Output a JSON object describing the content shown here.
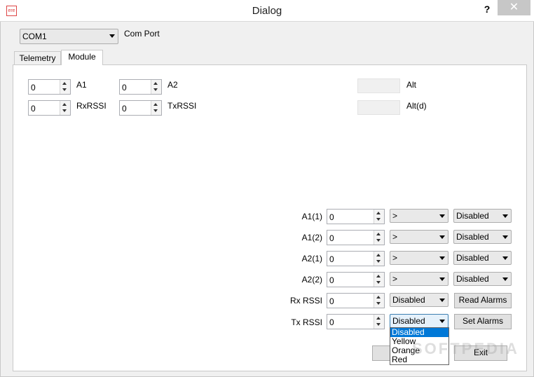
{
  "window": {
    "title": "Dialog",
    "help_label": "?",
    "close_label": "✕",
    "app_icon_text": "ere"
  },
  "com_port": {
    "selected": "COM1",
    "label": "Com Port"
  },
  "tabs": [
    {
      "label": "Telemetry",
      "selected": false
    },
    {
      "label": "Module",
      "selected": true
    }
  ],
  "module": {
    "a1": {
      "value": "0",
      "label": "A1"
    },
    "a2": {
      "value": "0",
      "label": "A2"
    },
    "rxrssi": {
      "value": "0",
      "label": "RxRSSI"
    },
    "txrssi": {
      "value": "0",
      "label": "TxRSSI"
    },
    "alt_label": "Alt",
    "altd_label": "Alt(d)"
  },
  "alarms": [
    {
      "label": "A1(1)",
      "value": "0",
      "op": ">",
      "level": "Disabled"
    },
    {
      "label": "A1(2)",
      "value": "0",
      "op": ">",
      "level": "Disabled"
    },
    {
      "label": "A2(1)",
      "value": "0",
      "op": ">",
      "level": "Disabled"
    },
    {
      "label": "A2(2)",
      "value": "0",
      "op": ">",
      "level": "Disabled"
    },
    {
      "label": "Rx RSSI",
      "value": "0",
      "level": "Disabled"
    },
    {
      "label": "Tx RSSI",
      "value": "0",
      "level": "Disabled"
    }
  ],
  "buttons": {
    "read_alarms": "Read Alarms",
    "set_alarms": "Set Alarms",
    "exit": "Exit"
  },
  "dropdown_options": [
    "Disabled",
    "Yellow",
    "Orange",
    "Red"
  ],
  "watermark": "SOFTPEDIA"
}
